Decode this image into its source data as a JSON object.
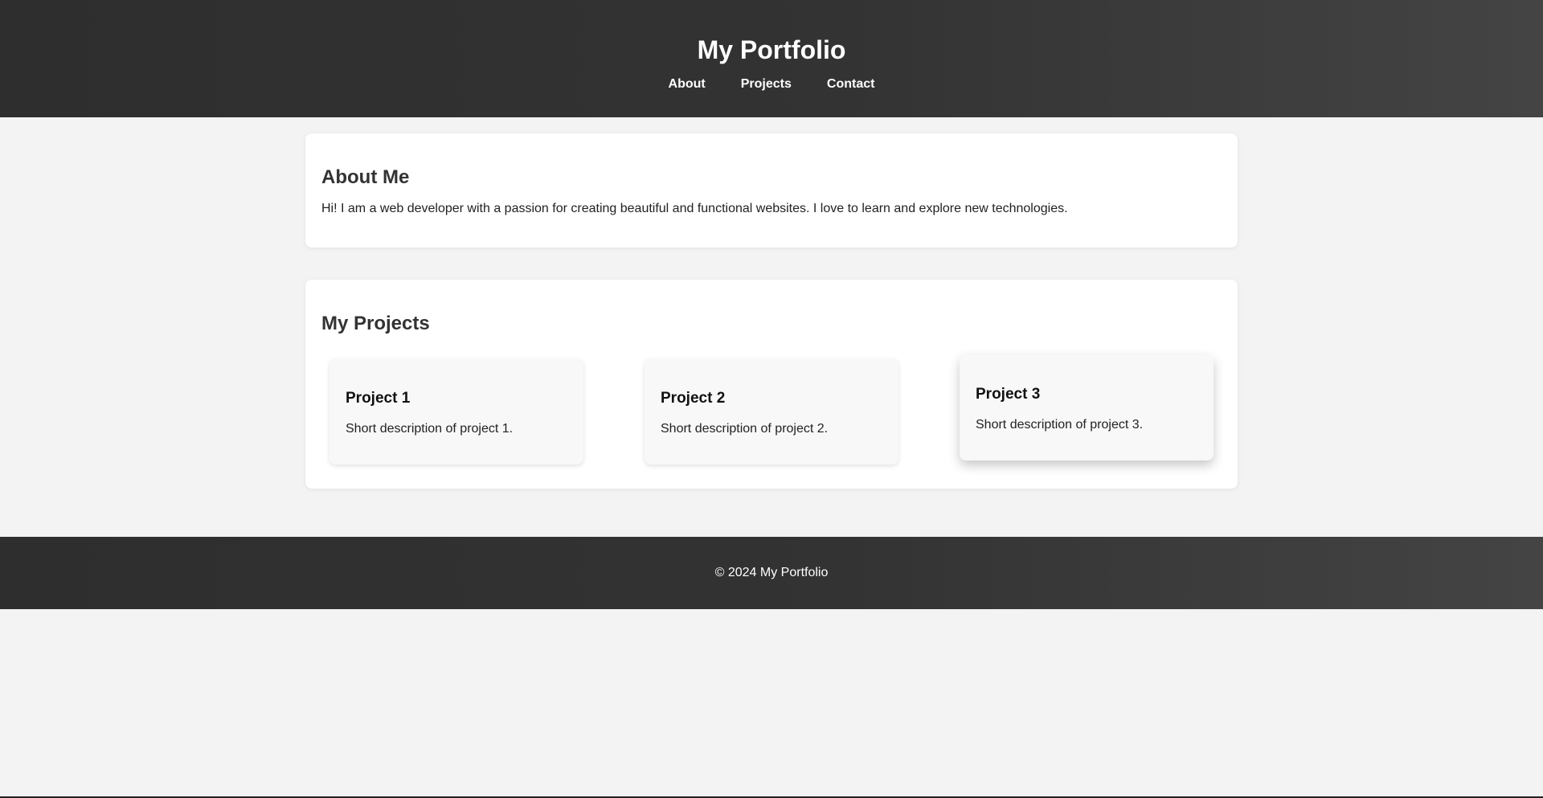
{
  "header": {
    "title": "My Portfolio",
    "nav": [
      {
        "label": "About"
      },
      {
        "label": "Projects"
      },
      {
        "label": "Contact"
      }
    ]
  },
  "about": {
    "heading": "About Me",
    "text": "Hi! I am a web developer with a passion for creating beautiful and functional websites. I love to learn and explore new technologies."
  },
  "projects": {
    "heading": "My Projects",
    "items": [
      {
        "title": "Project 1",
        "description": "Short description of project 1."
      },
      {
        "title": "Project 2",
        "description": "Short description of project 2."
      },
      {
        "title": "Project 3",
        "description": "Short description of project 3."
      }
    ]
  },
  "footer": {
    "text": "© 2024 My Portfolio"
  },
  "colors": {
    "header_bg": "#333333",
    "page_bg": "#f3f3f3",
    "card_bg": "#ffffff",
    "project_bg": "#f8f8f8"
  }
}
